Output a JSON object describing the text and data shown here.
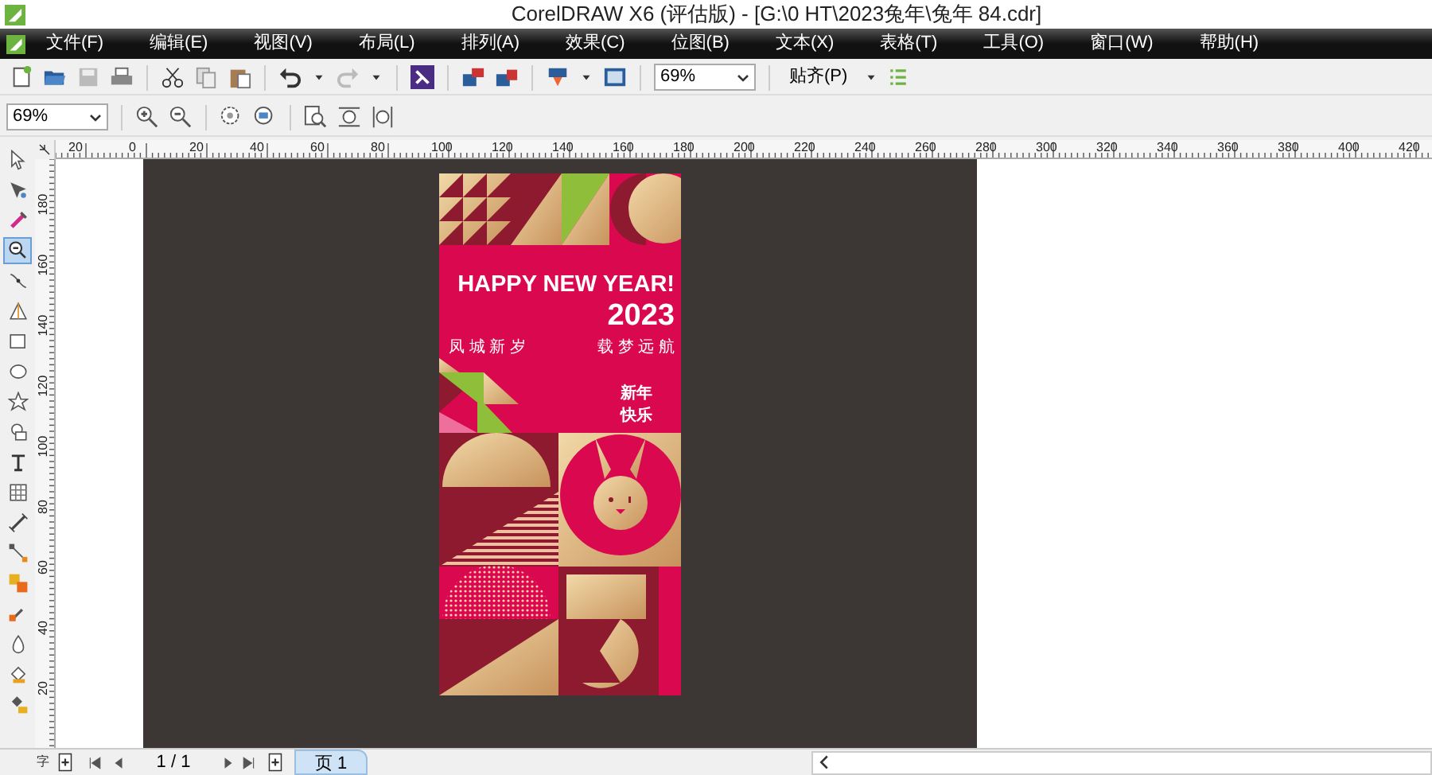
{
  "window": {
    "title": "CorelDRAW X6 (评估版) - [G:\\0 HT\\2023兔年\\兔年 84.cdr]"
  },
  "menu": [
    "文件(F)",
    "编辑(E)",
    "视图(V)",
    "布局(L)",
    "排列(A)",
    "效果(C)",
    "位图(B)",
    "文本(X)",
    "表格(T)",
    "工具(O)",
    "窗口(W)",
    "帮助(H)"
  ],
  "standard_toolbar": {
    "zoom_level": "69%",
    "snap": "贴齐(P)"
  },
  "zoom_toolbar": {
    "zoom_level": "69%"
  },
  "horizontal_ruler": [
    "20",
    "0",
    "20",
    "40",
    "60",
    "80",
    "100",
    "120",
    "140",
    "160",
    "180",
    "200",
    "220",
    "240",
    "260",
    "280",
    "300",
    "320",
    "340",
    "360",
    "380",
    "400",
    "420"
  ],
  "vertical_ruler": [
    "180",
    "160",
    "140",
    "120",
    "100",
    "80",
    "60",
    "40",
    "20"
  ],
  "toolbox": [
    {
      "kind": "pointer",
      "selected": false
    },
    {
      "kind": "shape",
      "selected": false
    },
    {
      "kind": "smear",
      "selected": false
    },
    {
      "kind": "zoom",
      "selected": true
    },
    {
      "kind": "curve",
      "selected": false
    },
    {
      "kind": "triangle",
      "selected": false
    },
    {
      "kind": "rectangle",
      "selected": false
    },
    {
      "kind": "ellipse",
      "selected": false
    },
    {
      "kind": "star",
      "selected": false
    },
    {
      "kind": "shapes",
      "selected": false
    },
    {
      "kind": "text",
      "selected": false
    },
    {
      "kind": "table",
      "selected": false
    },
    {
      "kind": "dimension",
      "selected": false
    },
    {
      "kind": "connector",
      "selected": false
    },
    {
      "kind": "blend",
      "selected": false
    },
    {
      "kind": "eyedropper",
      "selected": false
    },
    {
      "kind": "outline",
      "selected": false
    },
    {
      "kind": "fill",
      "selected": false
    },
    {
      "kind": "interactive-fill",
      "selected": false
    }
  ],
  "poster": {
    "headline": "HAPPY NEW YEAR!",
    "year": "2023",
    "tagline_left": "凤 城 新 岁",
    "tagline_right": "载 梦 远 航",
    "greeting_top": "新年",
    "greeting_bottom": "快乐"
  },
  "status_bar": {
    "page_count": "1 / 1",
    "page_tab": "页 1",
    "text_column": "字"
  }
}
